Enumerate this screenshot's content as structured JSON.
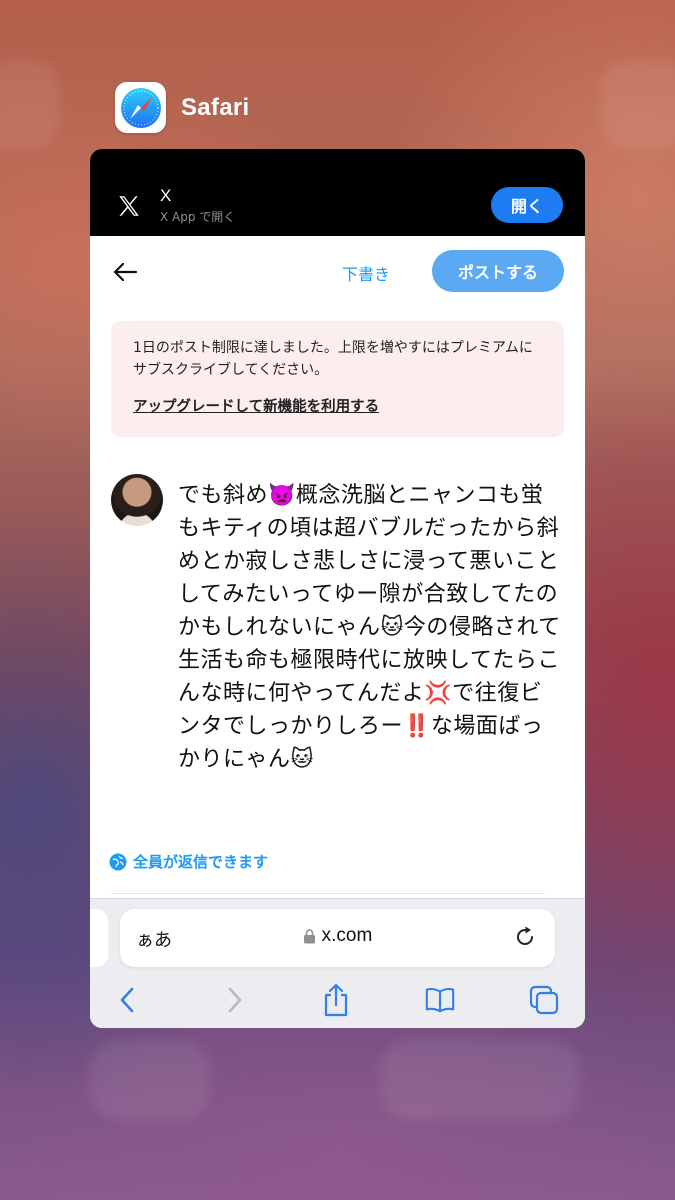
{
  "app": {
    "name": "Safari"
  },
  "banner": {
    "title": "X",
    "subtitle": "X App で開く",
    "open_label": "開く"
  },
  "composer": {
    "draft_label": "下書き",
    "post_label": "ポストする"
  },
  "limit_notice": {
    "message": "1日のポスト制限に達しました。上限を増やすにはプレミアムにサブスクライブしてください。",
    "link": "アップグレードして新機能を利用する"
  },
  "post": {
    "text": "でも斜め👿概念洗脳とニャンコも蛍もキティの頃は超バブルだったから斜めとか寂しさ悲しさに浸って悪いことしてみたいってゆー隙が合致してたのかもしれないにゃん🐱今の侵略されて生活も命も極限時代に放映してたらこんな時に何やってんだよ💢で往復ビンタでしっかりしろー‼️な場面ばっかりにゃん🐱"
  },
  "reply_setting": {
    "label": "全員が返信できます"
  },
  "address_bar": {
    "aa_label": "ぁあ",
    "url": "x.com"
  },
  "colors": {
    "accent": "#1d9bf0",
    "open_button": "#1d7cf2",
    "post_button": "#5aa9f2",
    "notice_bg": "#fdeeee"
  }
}
